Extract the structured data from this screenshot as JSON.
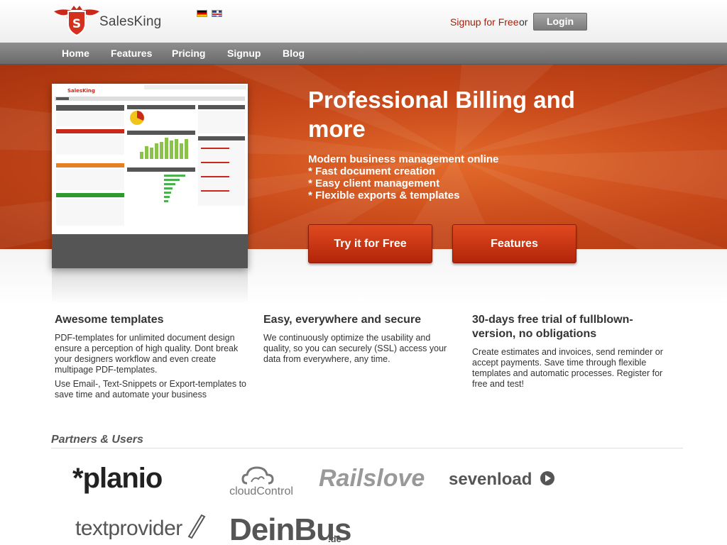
{
  "header": {
    "brand": "SalesKing",
    "signup_link": "Signup for Free",
    "or_text": "or",
    "login_label": "Login",
    "languages": [
      "german-flag",
      "uk-flag"
    ]
  },
  "nav": {
    "items": [
      {
        "label": "Home"
      },
      {
        "label": "Features"
      },
      {
        "label": "Pricing"
      },
      {
        "label": "Signup"
      },
      {
        "label": "Blog"
      }
    ]
  },
  "hero": {
    "title": "Professional Billing and more",
    "bullets": [
      "Modern business management online",
      "* Fast document creation",
      "* Easy client management",
      "* Flexible exports & templates"
    ],
    "cta_try": "Try it for Free",
    "cta_features": "Features"
  },
  "features": [
    {
      "heading": "Awesome templates",
      "paragraphs": [
        "PDF-templates for unlimited document design ensure a perception of high quality. Dont break your designers workflow and even create multipage PDF-templates.",
        "Use Email-, Text-Snippets or Export-templates to save time and automate your business"
      ]
    },
    {
      "heading": "Easy, everywhere and secure",
      "paragraphs": [
        "We continuously optimize the usability and quality, so you can securely (SSL) access your data from everywhere, any time."
      ]
    },
    {
      "heading": "30-days free trial of fullblown-version, no obligations",
      "paragraphs": [
        "Create estimates and invoices, send reminder or accept payments. Save time through flexible templates and automatic processes. Register for free and test!"
      ]
    }
  ],
  "partners": {
    "title": "Partners & Users",
    "logos": {
      "planio": "*planio",
      "cloudcontrol": "cloudControl",
      "railslove": "Railslove",
      "sevenload": "sevenload",
      "textprovider": "textprovider",
      "deinbus": "DeinBus",
      "deinbus_tld": ".de"
    }
  },
  "colors": {
    "brand_red": "#b21a00",
    "hero_orange": "#c8491a",
    "nav_gray": "#7c7c7c"
  }
}
